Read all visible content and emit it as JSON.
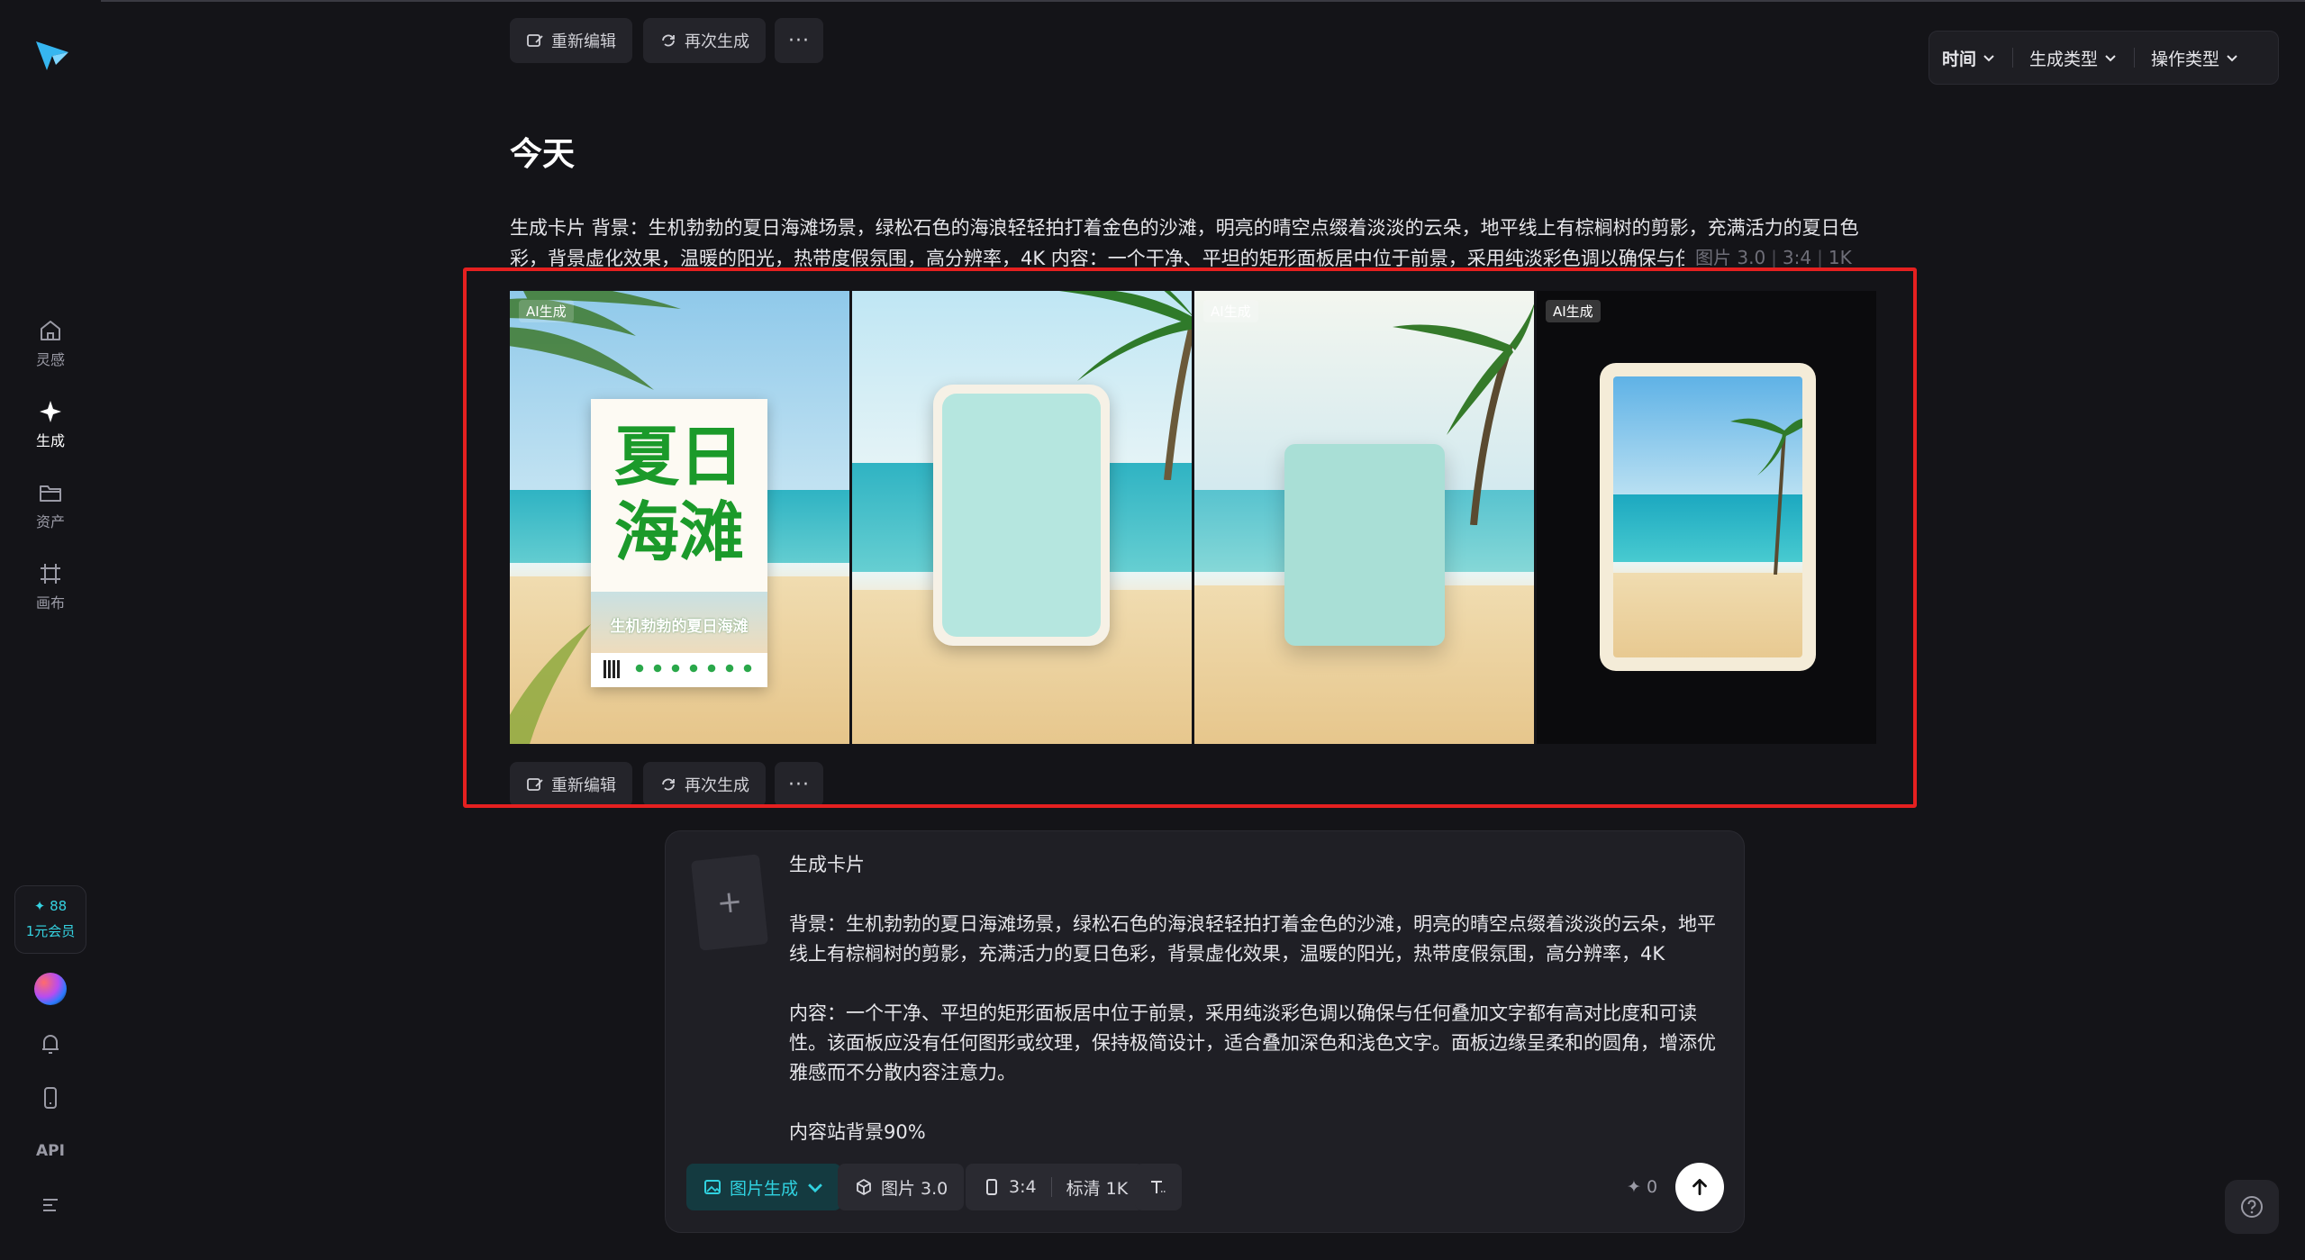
{
  "filters": {
    "time": "时间",
    "gen_type": "生成类型",
    "op_type": "操作类型"
  },
  "sidebar": {
    "items": [
      {
        "label": "灵感",
        "icon": "home-icon"
      },
      {
        "label": "生成",
        "icon": "sparkle-icon"
      },
      {
        "label": "资产",
        "icon": "folder-icon"
      },
      {
        "label": "画布",
        "icon": "canvas-icon"
      }
    ],
    "credits": "✦ 88",
    "member": "1元会员",
    "api": "API"
  },
  "actions": {
    "reedit": "重新编辑",
    "regen": "再次生成",
    "more": "···"
  },
  "feed": {
    "day": "今天",
    "prompt": "生成卡片 背景：生机勃勃的夏日海滩场景，绿松石色的海浪轻轻拍打着金色的沙滩，明亮的晴空点缀着淡淡的云朵，地平线上有棕榈树的剪影，充满活力的夏日色彩，背景虚化效果，温暖的阳光，热带度假氛围，高分辨率，4K 内容：一个干净、平坦的矩形面板居中位于前景，采用纯淡彩色调以确保与任",
    "meta": {
      "model": "图片 3.0",
      "ratio": "3:4",
      "res": "1K"
    },
    "badge": "AI生成",
    "poster": {
      "title": "夏日海滩",
      "subtitle": "生机勃勃的夏日海滩"
    }
  },
  "composer": {
    "text": "生成卡片\n\n背景：生机勃勃的夏日海滩场景，绿松石色的海浪轻轻拍打着金色的沙滩，明亮的晴空点缀着淡淡的云朵，地平线上有棕榈树的剪影，充满活力的夏日色彩，背景虚化效果，温暖的阳光，热带度假氛围，高分辨率，4K\n\n内容：一个干净、平坦的矩形面板居中位于前景，采用纯淡彩色调以确保与任何叠加文字都有高对比度和可读性。该面板应没有任何图形或纹理，保持极简设计，适合叠加深色和浅色文字。面板边缘呈柔和的圆角，增添优雅感而不分散内容注意力。\n\n内容站背景90%",
    "mode": "图片生成",
    "model": "图片 3.0",
    "ratio": "3:4",
    "quality": "标清 1K",
    "credits": "✦ 0"
  },
  "colors": {
    "accent": "#30d2e0",
    "highlight_border": "#e52020",
    "background": "#141418"
  }
}
